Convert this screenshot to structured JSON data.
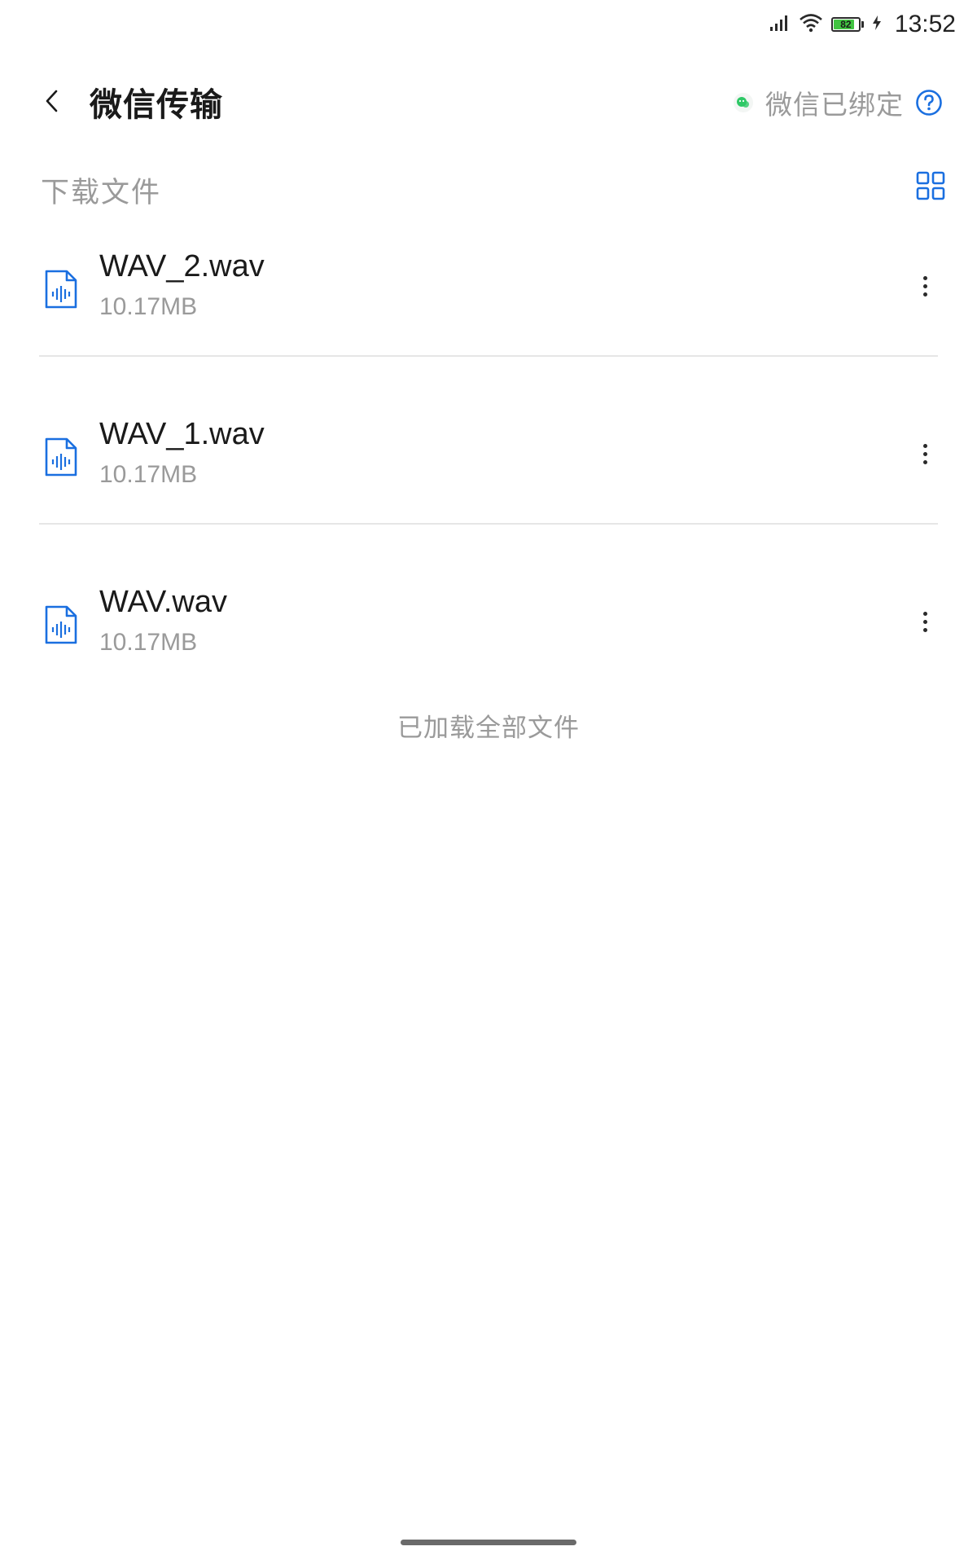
{
  "status_bar": {
    "time": "13:52",
    "battery_level": "82",
    "battery_fraction": 0.82,
    "icons": [
      "signal-icon",
      "wifi-icon",
      "battery-icon",
      "charging-icon"
    ]
  },
  "header": {
    "title": "微信传输",
    "bind_status": "微信已绑定",
    "back_icon": "chevron-left-icon",
    "help_icon": "question-circle-icon"
  },
  "section": {
    "title": "下载文件",
    "view_toggle_icon": "grid-view-icon"
  },
  "files": [
    {
      "name": "WAV_2.wav",
      "size": "10.17MB",
      "icon": "audio-file-icon"
    },
    {
      "name": "WAV_1.wav",
      "size": "10.17MB",
      "icon": "audio-file-icon"
    },
    {
      "name": "WAV.wav",
      "size": "10.17MB",
      "icon": "audio-file-icon"
    }
  ],
  "footer_text": "已加载全部文件",
  "colors": {
    "accent": "#1a6fe0",
    "wechat_green": "#2ec866",
    "secondary_text": "#9a9a9a",
    "primary_text": "#1a1a1a",
    "battery_green": "#41c441"
  }
}
